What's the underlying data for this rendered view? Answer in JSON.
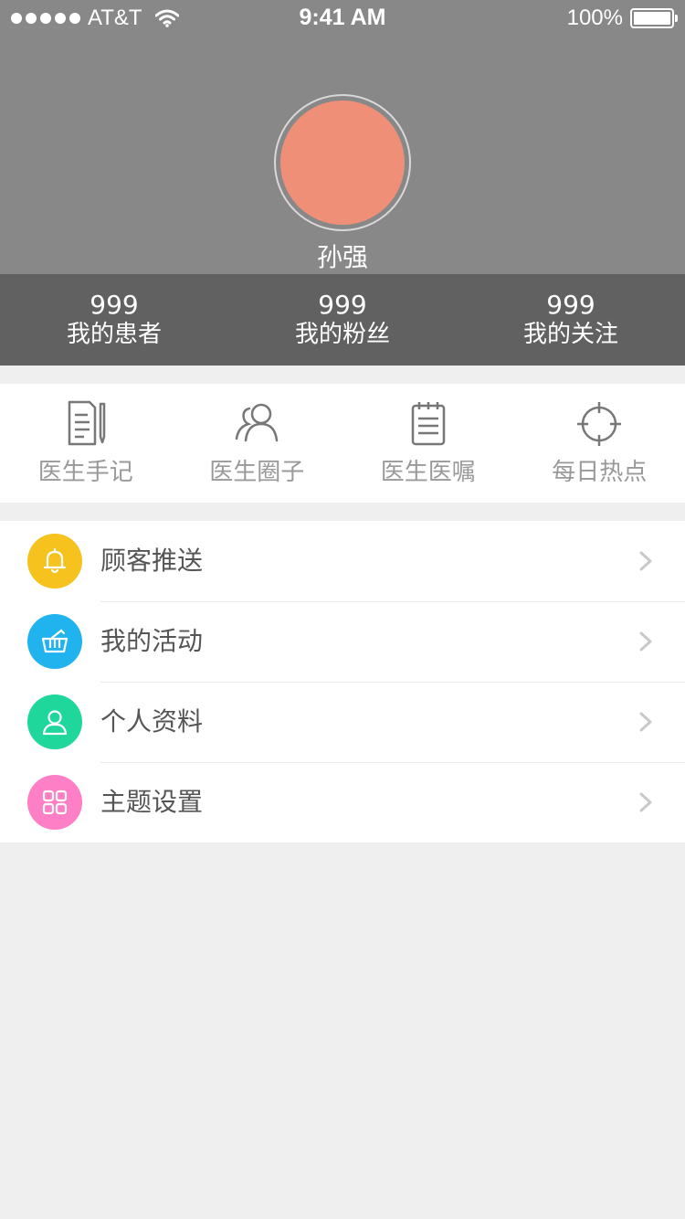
{
  "status_bar": {
    "carrier": "AT&T",
    "time": "9:41 AM",
    "battery": "100%"
  },
  "profile": {
    "name": "孙强"
  },
  "stats": [
    {
      "value": "999",
      "label": "我的患者"
    },
    {
      "value": "999",
      "label": "我的粉丝"
    },
    {
      "value": "999",
      "label": "我的关注"
    }
  ],
  "quick_menu": [
    {
      "label": "医生手记",
      "icon": "notes-icon"
    },
    {
      "label": "医生圈子",
      "icon": "group-icon"
    },
    {
      "label": "医生医嘱",
      "icon": "clipboard-icon"
    },
    {
      "label": "每日热点",
      "icon": "target-icon"
    }
  ],
  "menu_list": [
    {
      "label": "顾客推送",
      "icon": "bell-icon",
      "color": "#f6c21d"
    },
    {
      "label": "我的活动",
      "icon": "basket-icon",
      "color": "#21b3ee"
    },
    {
      "label": "个人资料",
      "icon": "user-icon",
      "color": "#1fd79b"
    },
    {
      "label": "主题设置",
      "icon": "grid-icon",
      "color": "#ff7fc6"
    }
  ],
  "colors": {
    "header_bg": "#888888",
    "stats_bg": "#616161",
    "avatar": "#ef8f78",
    "page_bg": "#efefef",
    "quick_label": "#999999"
  }
}
